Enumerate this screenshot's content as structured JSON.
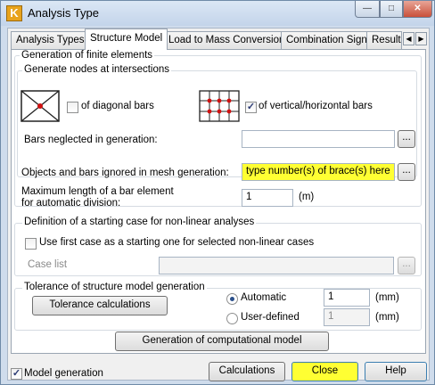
{
  "window": {
    "title": "Analysis Type",
    "icon_letter": "K",
    "min_glyph": "—",
    "max_glyph": "□",
    "close_glyph": "✕"
  },
  "tabs": [
    {
      "label": "Analysis Types"
    },
    {
      "label": "Structure Model"
    },
    {
      "label": "Load to Mass Conversion"
    },
    {
      "label": "Combination Sign"
    },
    {
      "label": "Result I"
    }
  ],
  "tab_scroll": {
    "left": "◀",
    "right": "▶"
  },
  "generation": {
    "group_label": "Generation of finite elements",
    "nodes_group_label": "Generate nodes at intersections",
    "diagonal_label": "of diagonal bars",
    "diagonal_checked": false,
    "vertical_label": "of vertical/horizontal bars",
    "vertical_checked": true,
    "bars_neglected_label": "Bars neglected in generation:",
    "bars_neglected_value": "",
    "browse_glyph": "..."
  },
  "mesh": {
    "ignored_label": "Objects and bars ignored in mesh generation:",
    "ignored_value": "type number(s) of brace(s) here",
    "max_length_label_1": "Maximum length of a bar element",
    "max_length_label_2": "for automatic division:",
    "max_length_value": "1",
    "max_length_unit": "(m)"
  },
  "nonlinear": {
    "group_label": "Definition of a starting case for non-linear analyses",
    "use_first_label": "Use first case as a starting one for selected non-linear cases",
    "use_first_checked": false,
    "case_list_label": "Case list",
    "case_list_value": ""
  },
  "tolerance": {
    "group_label": "Tolerance of structure model generation",
    "calc_button": "Tolerance calculations",
    "automatic_label": "Automatic",
    "automatic_selected": true,
    "automatic_value": "1",
    "user_label": "User-defined",
    "user_value": "1",
    "unit": "(mm)"
  },
  "generate_button": "Generation of computational model",
  "footer": {
    "model_generation_label": "Model generation",
    "model_generation_checked": true,
    "calculations_button": "Calculations",
    "close_button": "Close",
    "help_button": "Help"
  }
}
